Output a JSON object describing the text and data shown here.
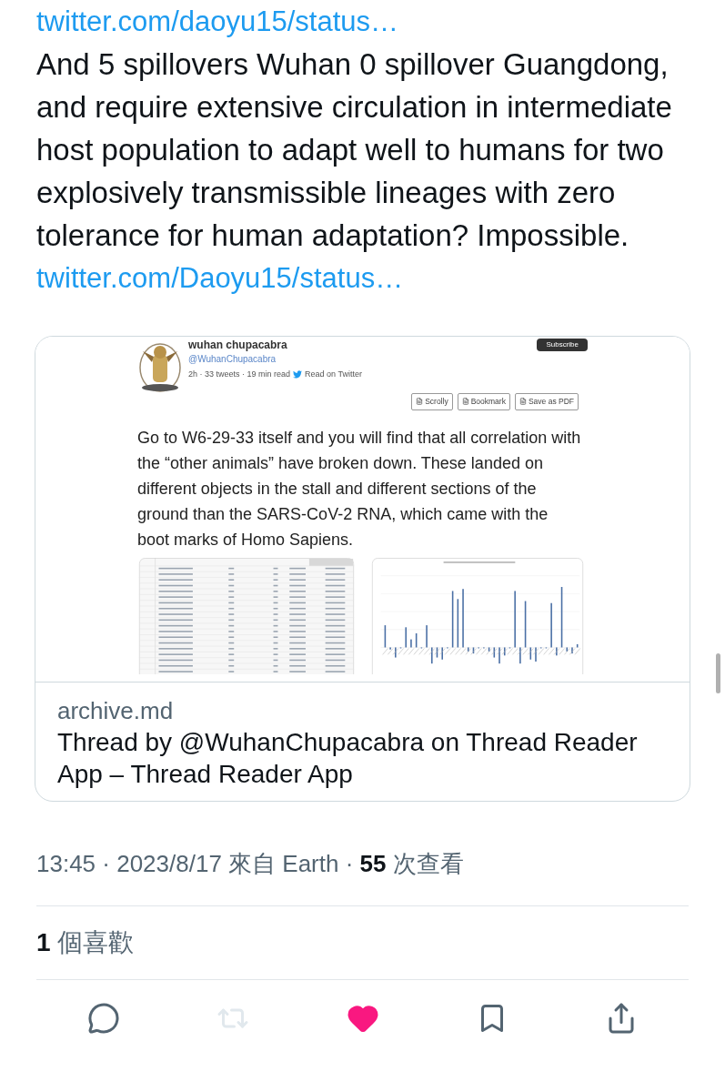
{
  "tweet": {
    "body": [
      {
        "kind": "link",
        "text": "twitter.com/daoyu15/status…"
      },
      {
        "kind": "text",
        "text": "And 5 spillovers Wuhan 0 spillover Guangdong, and require extensive circulation in intermediate host population to adapt well to humans for two explosively transmissible lineages with zero tolerance for human adaptation? Impossible."
      },
      {
        "kind": "link",
        "text": "twitter.com/Daoyu15/status…"
      }
    ]
  },
  "card": {
    "preview": {
      "author_name": "wuhan chupacabra",
      "handle": "@WuhanChupacabra",
      "meta": "2h · 33 tweets · 19 min read",
      "read_on": "Read on Twitter",
      "subscribe": "Subscribe",
      "buttons": [
        "Scrolly",
        "Bookmark",
        "Save as PDF"
      ],
      "text": "Go to W6-29-33 itself and you will find that all correlation with the “other animals” have broken down. These landed on different objects in the stall and different sections of the ground than the SARS-CoV-2 RNA, which came with the boot marks of Homo Sapiens."
    },
    "domain": "archive.md",
    "title": "Thread by @WuhanChupacabra on Thread Reader App – Thread Reader App"
  },
  "meta": "13:45 · 2023/8/17 來自 Earth · **55** 次查看",
  "likes": "**1** 個喜歡",
  "actions": [
    {
      "kind": "reply",
      "disabled": false,
      "on": false
    },
    {
      "kind": "retweet",
      "disabled": true,
      "on": false
    },
    {
      "kind": "like",
      "disabled": false,
      "on": true
    },
    {
      "kind": "bookmark",
      "disabled": false,
      "on": false
    },
    {
      "kind": "share",
      "disabled": false,
      "on": false
    }
  ]
}
